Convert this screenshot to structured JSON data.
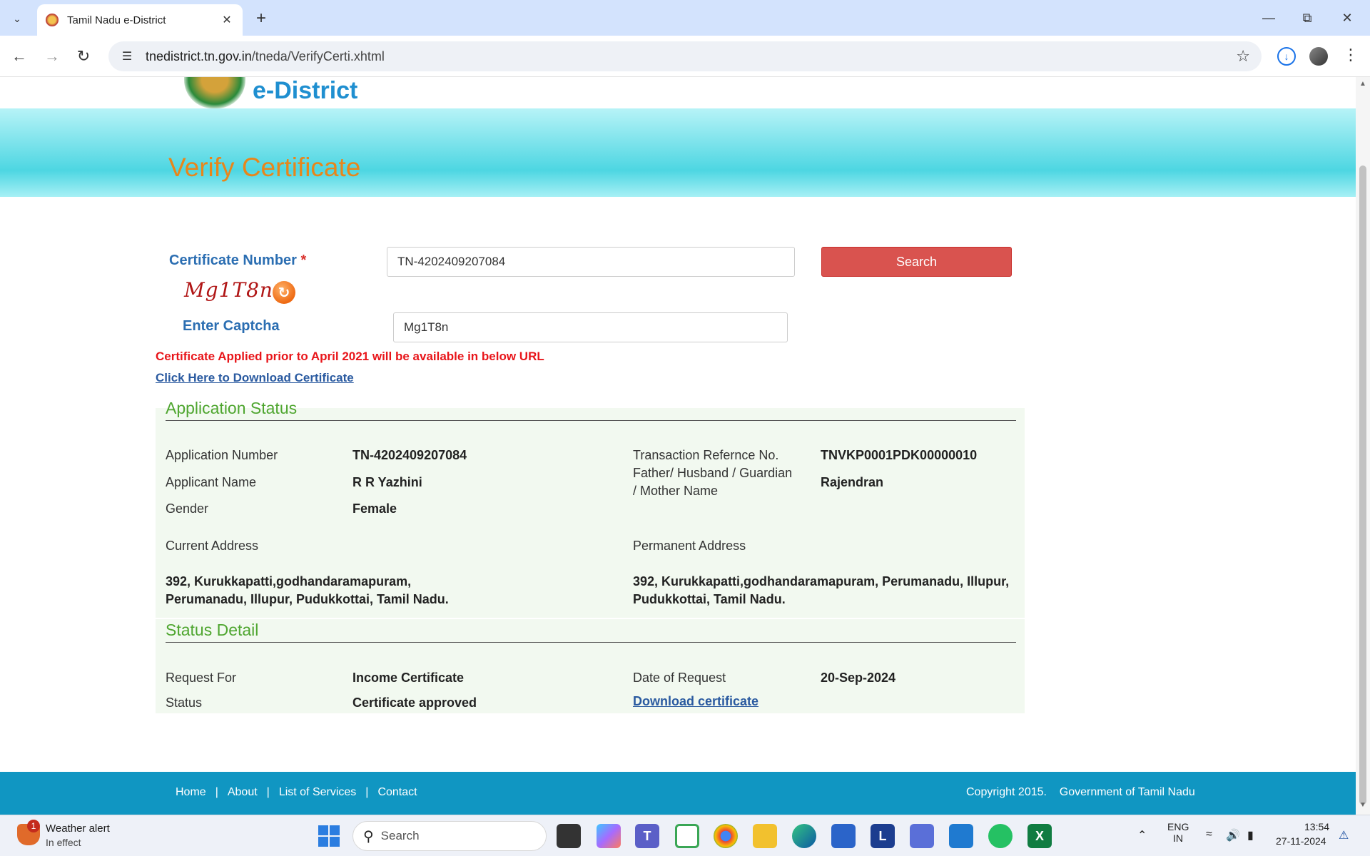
{
  "browser": {
    "tab_title": "Tamil Nadu e-District",
    "url_host": "tnedistrict.tn.gov.in",
    "url_path": "/tneda/VerifyCerti.xhtml"
  },
  "page": {
    "logo_text": "e-District",
    "banner_title": "Verify Certificate"
  },
  "form": {
    "certificate_label": "Certificate Number",
    "required_mark": "*",
    "certificate_value": "TN-4202409207084",
    "search_label": "Search",
    "captcha_text": "Mg1T8n",
    "captcha_label": "Enter Captcha",
    "captcha_value": "Mg1T8n",
    "notice": "Certificate Applied prior to April 2021 will be available in below URL",
    "download_link": "Click Here to Download Certificate"
  },
  "application_status": {
    "title": "Application Status",
    "application_number_label": "Application Number",
    "application_number": "TN-4202409207084",
    "transaction_label": "Transaction Refernce No.",
    "transaction_value": "TNVKP0001PDK00000010",
    "applicant_name_label": "Applicant Name",
    "applicant_name": "R R Yazhini",
    "guardian_label": "Father/ Husband / Guardian / Mother Name",
    "guardian_value": "Rajendran",
    "gender_label": "Gender",
    "gender": "Female",
    "current_address_label": "Current Address",
    "current_address": "392, Kurukkapatti,godhandaramapuram, Perumanadu, Illupur, Pudukkottai, Tamil Nadu.",
    "permanent_address_label": "Permanent Address",
    "permanent_address": "392, Kurukkapatti,godhandaramapuram, Perumanadu, Illupur, Pudukkottai, Tamil Nadu."
  },
  "status_detail": {
    "title": "Status Detail",
    "request_for_label": "Request For",
    "request_for": "Income Certificate",
    "date_label": "Date of Request",
    "date_value": "20-Sep-2024",
    "status_label": "Status",
    "status_value": "Certificate approved",
    "download_link": "Download certificate"
  },
  "footer": {
    "nav": [
      "Home",
      "About",
      "List of Services",
      "Contact"
    ],
    "separator": "|",
    "copyright": "Copyright 2015.    Government of Tamil Nadu"
  },
  "taskbar": {
    "weather_title": "Weather alert",
    "weather_sub": "In effect",
    "weather_badge": "1",
    "search_placeholder": "Search",
    "lang_top": "ENG",
    "lang_bottom": "IN",
    "time": "13:54",
    "date": "27-11-2024"
  },
  "colors": {
    "accent_orange": "#e8861a",
    "label_blue": "#2b6eb2",
    "section_green": "#4fa630",
    "search_red": "#d9534f",
    "footer_blue": "#1096c2"
  }
}
